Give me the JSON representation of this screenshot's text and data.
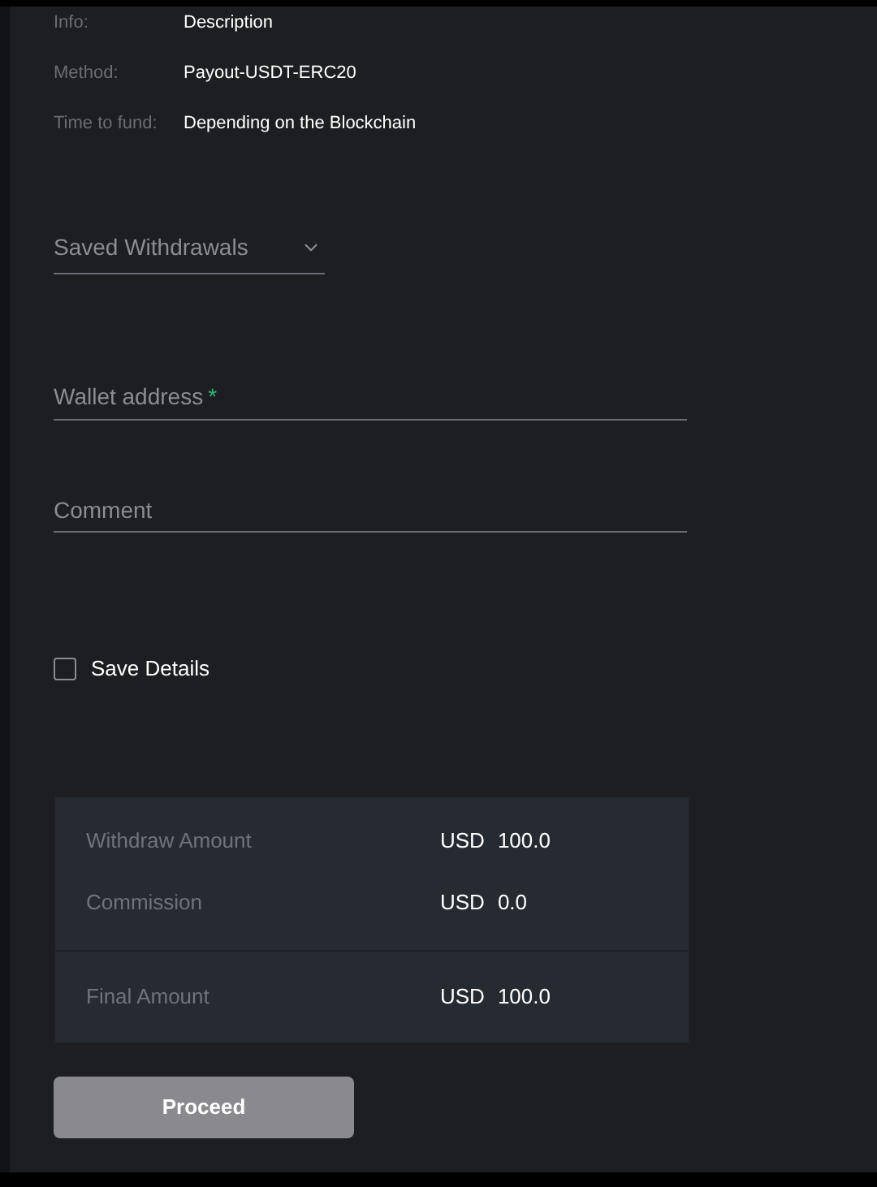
{
  "details": [
    {
      "label": "Info:",
      "value": "Description"
    },
    {
      "label": "Method:",
      "value": "Payout-USDT-ERC20"
    },
    {
      "label": "Time to fund:",
      "value": "Depending on the Blockchain"
    }
  ],
  "saved_withdrawals": {
    "label": "Saved Withdrawals"
  },
  "wallet_address": {
    "placeholder": "Wallet address",
    "required_mark": "*"
  },
  "comment": {
    "placeholder": "Comment"
  },
  "save_details": {
    "label": "Save Details",
    "checked": false
  },
  "summary": [
    {
      "label": "Withdraw Amount",
      "currency": "USD",
      "amount": "100.0"
    },
    {
      "label": "Commission",
      "currency": "USD",
      "amount": "0.0"
    },
    {
      "label": "Final Amount",
      "currency": "USD",
      "amount": "100.0",
      "total": true
    }
  ],
  "proceed_button": {
    "label": "Proceed"
  }
}
